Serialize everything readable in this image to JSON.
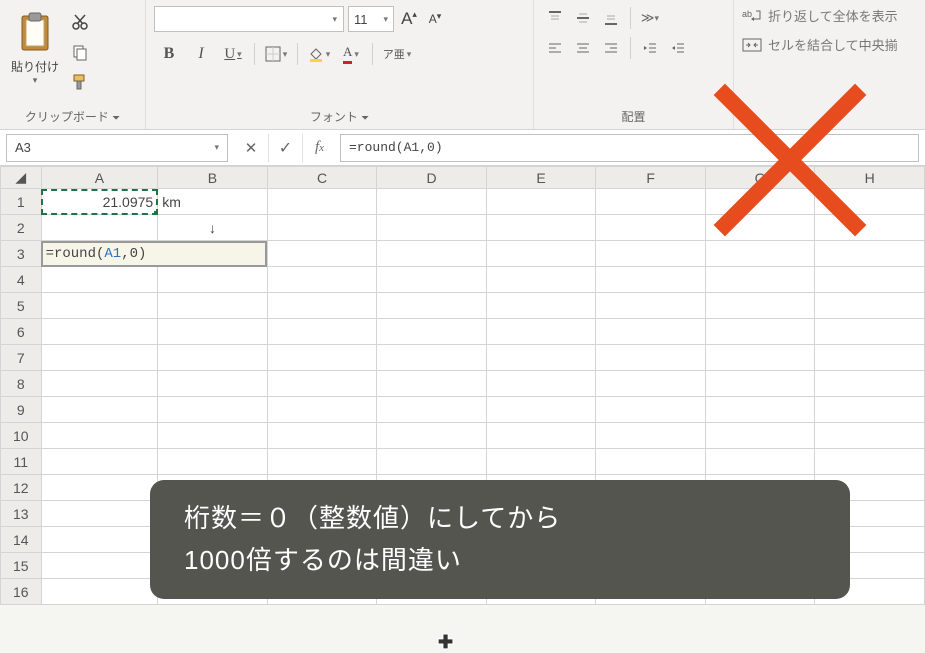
{
  "ribbon": {
    "clipboard": {
      "paste_label": "貼り付け",
      "group_label": "クリップボード"
    },
    "font": {
      "name": "",
      "size": "11",
      "group_label": "フォント",
      "bold": "B",
      "italic": "I",
      "underline": "U",
      "font_large": "A",
      "font_small": "A",
      "ruby": "ア亜"
    },
    "alignment": {
      "group_label": "配置"
    },
    "wrap": {
      "wrap_label": "折り返して全体を表示",
      "merge_label": "セルを結合して中央揃"
    }
  },
  "formula_bar": {
    "name_box": "A3",
    "formula": "=round(A1,0)"
  },
  "grid": {
    "columns": [
      "A",
      "B",
      "C",
      "D",
      "E",
      "F",
      "G",
      "H"
    ],
    "rows": [
      1,
      2,
      3,
      4,
      5,
      6,
      7,
      8,
      9,
      10,
      11,
      12,
      13,
      14,
      15,
      16
    ],
    "cells": {
      "A1": "21.0975",
      "B1": "km",
      "B2": "↓",
      "A3_prefix": "=round(",
      "A3_ref": "A1",
      "A3_suffix": ",0)"
    }
  },
  "annotation": {
    "line1": "桁数＝０（整数値）にしてから",
    "line2": "1000倍するのは間違い"
  }
}
